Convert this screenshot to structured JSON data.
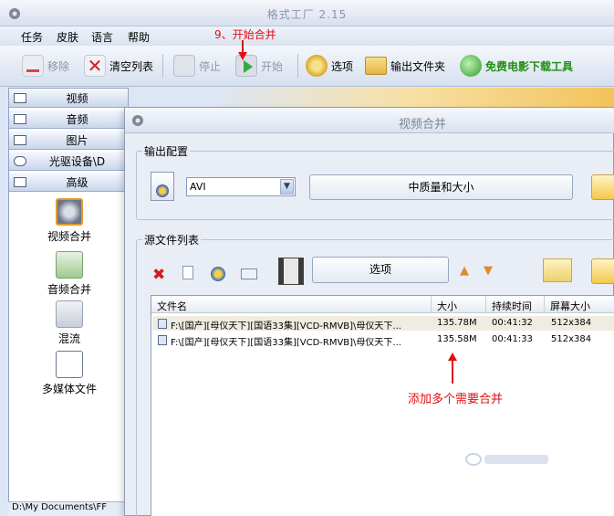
{
  "app": {
    "title": "格式工厂 2.15"
  },
  "menu": [
    "任务",
    "皮肤",
    "语言",
    "帮助"
  ],
  "toolbar": {
    "remove": "移除",
    "clear_list": "清空列表",
    "stop": "停止",
    "start": "开始",
    "options": "选项",
    "output_folder": "输出文件夹",
    "free_movie": "免费电影下载工具"
  },
  "annotation": {
    "step": "9、开始合并",
    "note": "添加多个需要合并"
  },
  "left_panel": {
    "categories": [
      "视频",
      "音频",
      "图片",
      "光驱设备\\D",
      "高级"
    ],
    "tools": [
      "视频合并",
      "音频合并",
      "混流",
      "多媒体文件"
    ]
  },
  "status_path": "D:\\My Documents\\FF",
  "dialog": {
    "title": "视频合并",
    "output_config": "输出配置",
    "format_value": "AVI",
    "quality_button": "中质量和大小",
    "source_list": "源文件列表",
    "option_button": "选项",
    "columns": [
      "文件名",
      "大小",
      "持续时间",
      "屏幕大小"
    ],
    "rows": [
      {
        "name": "F:\\[国产][母仪天下][国语33集][VCD-RMVB]\\母仪天下...",
        "size": "135.78M",
        "duration": "00:41:32",
        "resolution": "512x384"
      },
      {
        "name": "F:\\[国产][母仪天下][国语33集][VCD-RMVB]\\母仪天下...",
        "size": "135.58M",
        "duration": "00:41:33",
        "resolution": "512x384"
      }
    ]
  },
  "colors": {
    "annotation": "#e01010",
    "accent_green": "#1f8f10"
  }
}
